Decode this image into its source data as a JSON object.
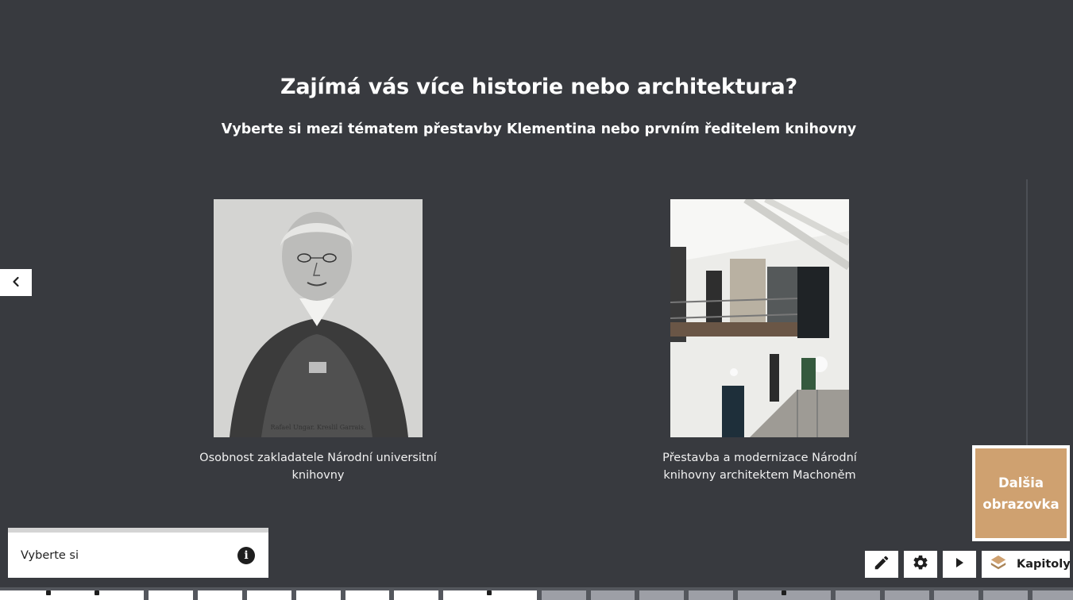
{
  "header": {
    "title": "Zajímá vás více historie nebo architektura?",
    "subtitle": "Vyberte si mezi tématem přestavby Klementina nebo prvním ředitelem knihovny"
  },
  "navigation": {
    "prev_icon": "chevron-left-icon",
    "next_label": "Dalšia obrazovka"
  },
  "choices": [
    {
      "image": "portrait-engraving",
      "image_caption": "Rafael Ungar. Kreslil Garrais.",
      "caption": "Osobnost zakladatele Národní universitní knihovny"
    },
    {
      "image": "library-interior-photo",
      "caption": "Přestavba a modernizace Národní knihovny architektem Machoněm"
    }
  ],
  "info_panel": {
    "label": "Vyberte si",
    "icon": "info-icon"
  },
  "toolbar": {
    "edit_icon": "pencil-icon",
    "settings_icon": "gear-icon",
    "play_icon": "play-icon",
    "chapters_icon": "layers-icon",
    "chapters_label": "Kapitoly"
  },
  "timeline": {
    "total_segments": 22,
    "completed_segments": 10,
    "colors": {
      "done": "#ffffff",
      "todo": "#9d9fa6",
      "accent": "#cfa170"
    }
  }
}
